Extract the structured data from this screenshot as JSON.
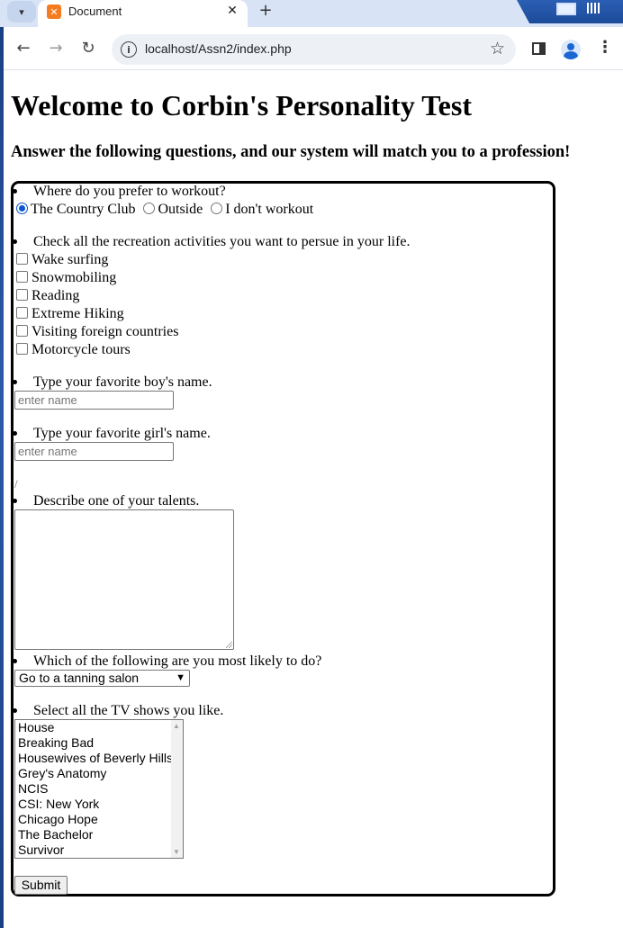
{
  "browser": {
    "tab_title": "Document",
    "tab_favicon": "xampp-icon",
    "url": "localhost/Assn2/index.php"
  },
  "page": {
    "title": "Welcome to Corbin's Personality Test",
    "subtitle": "Answer the following questions, and our system will match you to a profession!"
  },
  "form": {
    "q1": {
      "prompt": "Where do you prefer to workout?",
      "options": [
        "The Country Club",
        "Outside",
        "I don't workout"
      ],
      "selected": "The Country Club"
    },
    "q2": {
      "prompt": "Check all the recreation activities you want to persue in your life.",
      "options": [
        "Wake surfing",
        "Snowmobiling",
        "Reading",
        "Extreme Hiking",
        "Visiting foreign countries",
        "Motorcycle tours"
      ]
    },
    "q3": {
      "prompt": "Type your favorite boy's name.",
      "placeholder": "enter name"
    },
    "q4": {
      "prompt": "Type your favorite girl's name.",
      "placeholder": "enter name"
    },
    "stray_mark": "/",
    "q5": {
      "prompt": "Describe one of your talents."
    },
    "q6": {
      "prompt": "Which of the following are you most likely to do?",
      "selected": "Go to a tanning salon"
    },
    "q7": {
      "prompt": "Select all the TV shows you like.",
      "options": [
        "House",
        "Breaking Bad",
        "Housewives of Beverly Hills",
        "Grey's Anatomy",
        "NCIS",
        "CSI: New York",
        "Chicago Hope",
        "The Bachelor",
        "Survivor"
      ]
    },
    "submit_label": "Submit"
  }
}
